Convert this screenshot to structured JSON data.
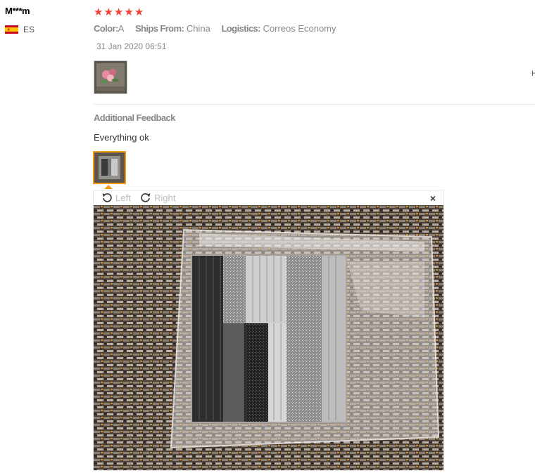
{
  "reviewer": {
    "name": "M***m",
    "country": "ES"
  },
  "rating": {
    "stars": 5,
    "max": 5
  },
  "attributes": [
    {
      "key": "Color:",
      "value": "A"
    },
    {
      "key": "Ships From:",
      "value": "China"
    },
    {
      "key": "Logistics:",
      "value": "Correos Economy"
    }
  ],
  "date": "31 Jan 2020 06:51",
  "edge_text": "H",
  "additional": {
    "title": "Additional Feedback",
    "text": "Everything ok"
  },
  "viewer": {
    "rotate_left": "Left",
    "rotate_right": "Right",
    "close": "×"
  },
  "colors": {
    "star": "#f44336",
    "accent": "#f39c12"
  }
}
